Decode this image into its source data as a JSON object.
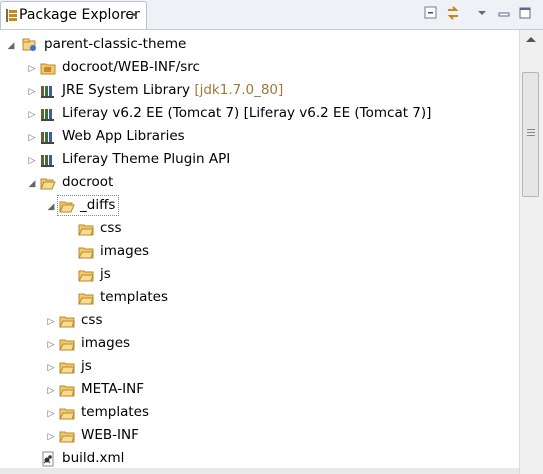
{
  "view": {
    "tab_label": "Package Explorer",
    "close_glyph": "✕"
  },
  "toolbar": {
    "collapse_all": "collapse-all-icon",
    "link_editor": "link-with-editor-icon",
    "view_menu": "view-menu-icon",
    "minimize": "minimize-icon",
    "maximize": "maximize-icon"
  },
  "tree": {
    "project": "parent-classic-theme",
    "items": [
      {
        "label": "docroot/WEB-INF/src"
      },
      {
        "label": "JRE System Library",
        "decoration": "[jdk1.7.0_80]"
      },
      {
        "label": "Liferay v6.2 EE (Tomcat 7) [Liferay v6.2 EE (Tomcat 7)]"
      },
      {
        "label": "Web App Libraries"
      },
      {
        "label": "Liferay Theme Plugin API"
      },
      {
        "label": "docroot"
      },
      {
        "label": "_diffs"
      },
      {
        "label": "css"
      },
      {
        "label": "images"
      },
      {
        "label": "js"
      },
      {
        "label": "templates"
      },
      {
        "label": "css"
      },
      {
        "label": "images"
      },
      {
        "label": "js"
      },
      {
        "label": "META-INF"
      },
      {
        "label": "templates"
      },
      {
        "label": "WEB-INF"
      },
      {
        "label": "build.xml"
      }
    ]
  },
  "colors": {
    "folder": "#e8b84a",
    "selection_outline": "#888888",
    "decoration": "#9b7a3c"
  }
}
